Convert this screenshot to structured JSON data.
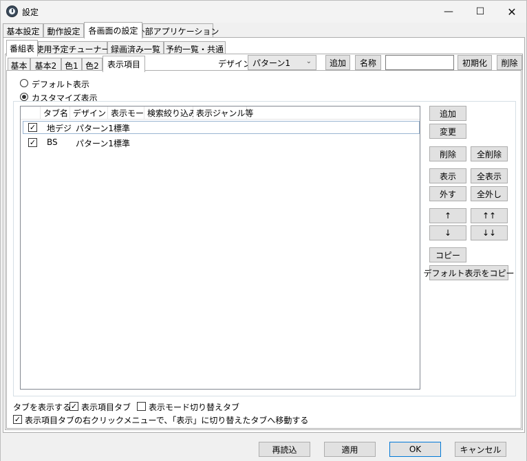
{
  "window": {
    "title": "設定",
    "minimize": "—",
    "maximize": "☐",
    "close": "✕"
  },
  "main_tabs": [
    "基本設定",
    "動作設定",
    "各画面の設定",
    "外部アプリケーション"
  ],
  "sub_tabs": [
    "番組表",
    "使用予定チューナー",
    "録画済み一覧",
    "予約一覧・共通"
  ],
  "inner_tabs": [
    "基本",
    "基本2",
    "色1",
    "色2",
    "表示項目"
  ],
  "design": {
    "label": "デザイン",
    "selected": "パターン1",
    "add": "追加",
    "name": "名称",
    "name_value": "",
    "init": "初期化",
    "delete": "削除"
  },
  "mode": {
    "default": "デフォルト表示",
    "custom": "カスタマイズ表示"
  },
  "list": {
    "columns": [
      "タブ名",
      "デザイン",
      "表示モード",
      "検索絞り込み",
      "表示ジャンル等"
    ],
    "rows": [
      {
        "checked": true,
        "tab": "地デジ",
        "design": "パターン1",
        "mode": "標準"
      },
      {
        "checked": true,
        "tab": "BS",
        "design": "パターン1",
        "mode": "標準"
      }
    ]
  },
  "side_buttons": {
    "add": "追加",
    "change": "変更",
    "delete": "削除",
    "delete_all": "全削除",
    "show": "表示",
    "show_all": "全表示",
    "hide": "外す",
    "hide_all": "全外し",
    "up": "↑",
    "top": "↑↑",
    "down": "↓",
    "bottom": "↓↓",
    "copy": "コピー",
    "copy_default": "デフォルト表示をコピー"
  },
  "options": {
    "show_tabs_label": "タブを表示する",
    "item_tab": "表示項目タブ",
    "mode_switch_tab": "表示モード切り替えタブ",
    "move_option": "表示項目タブの右クリックメニューで、「表示」に切り替えたタブへ移動する"
  },
  "footer": {
    "reload": "再読込",
    "apply": "適用",
    "ok": "OK",
    "cancel": "キャンセル"
  }
}
